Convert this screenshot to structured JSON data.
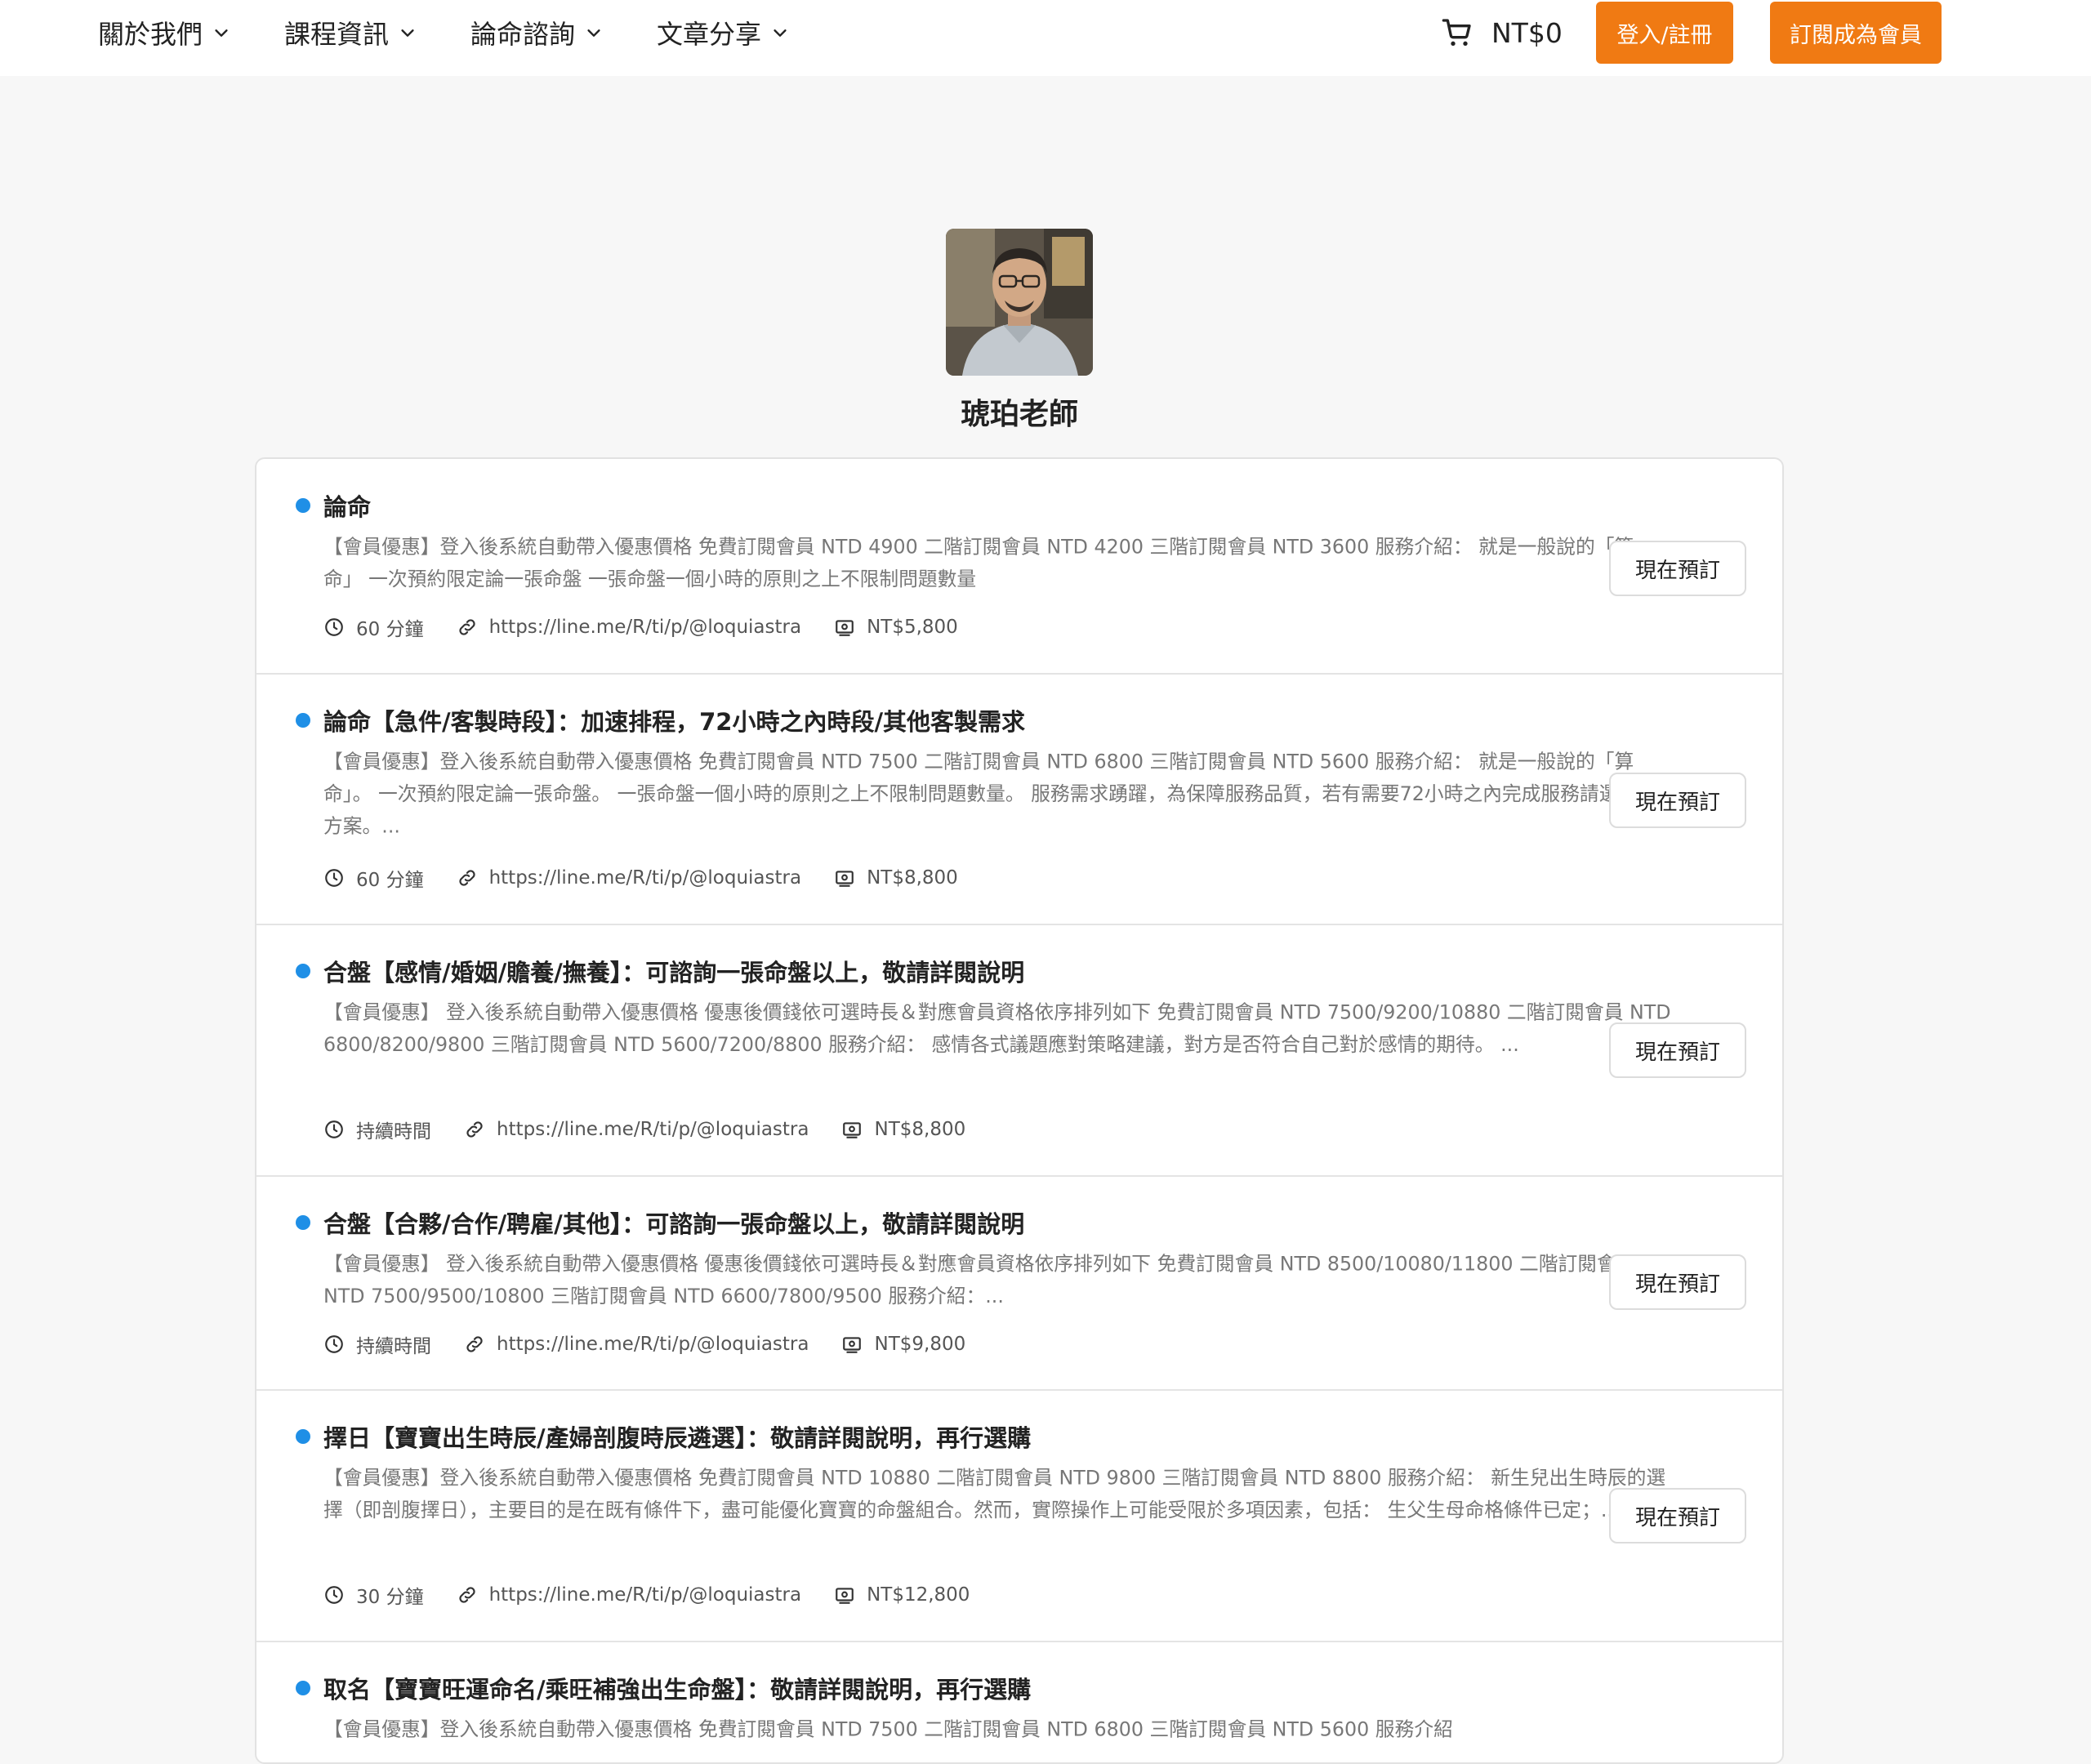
{
  "nav": {
    "items": [
      {
        "label": "關於我們"
      },
      {
        "label": "課程資訊"
      },
      {
        "label": "論命諮詢"
      },
      {
        "label": "文章分享"
      }
    ],
    "cart_total": "NT$0",
    "login_label": "登入/註冊",
    "subscribe_label": "訂閱成為會員"
  },
  "profile": {
    "name": "琥珀老師"
  },
  "colors": {
    "accent": "#f07a13",
    "bullet": "#1f8fe6"
  },
  "services": [
    {
      "title": "論命",
      "description": "【會員優惠】登入後系統自動帶入優惠價格 免費訂閱會員 NTD 4900 二階訂閱會員 NTD 4200 三階訂閱會員 NTD 3600 服務介紹： 就是一般說的「算命」 一次預約限定論一張命盤 一張命盤一個小時的原則之上不限制問題數量",
      "duration": "60 分鐘",
      "link": "https://line.me/R/ti/p/@loquiastra",
      "price": "NT$5,800",
      "book_label": "現在預訂"
    },
    {
      "title": "論命【急件/客製時段】：加速排程，72小時之內時段/其他客製需求",
      "description": "【會員優惠】登入後系統自動帶入優惠價格 免費訂閱會員 NTD 7500 二階訂閱會員 NTD 6800 三階訂閱會員 NTD 5600 服務介紹： 就是一般說的「算命」。 一次預約限定論一張命盤。 一張命盤一個小時的原則之上不限制問題數量。 服務需求踴躍，為保障服務品質，若有需要72小時之內完成服務請選擇此方案。...",
      "duration": "60 分鐘",
      "link": "https://line.me/R/ti/p/@loquiastra",
      "price": "NT$8,800",
      "book_label": "現在預訂"
    },
    {
      "title": "合盤【感情/婚姻/贍養/撫養】：可諮詢一張命盤以上，敬請詳閱說明",
      "description": "【會員優惠】 登入後系統自動帶入優惠價格 優惠後價錢依可選時長＆對應會員資格依序排列如下 免費訂閱會員 NTD 7500/9200/10880 二階訂閱會員 NTD 6800/8200/9800 三階訂閱會員 NTD 5600/7200/8800 服務介紹： 感情各式議題應對策略建議，對方是否符合自己對於感情的期待。 ...",
      "duration": "持續時間",
      "link": "https://line.me/R/ti/p/@loquiastra",
      "price": "NT$8,800",
      "book_label": "現在預訂"
    },
    {
      "title": "合盤【合夥/合作/聘雇/其他】：可諮詢一張命盤以上，敬請詳閱說明",
      "description": "【會員優惠】 登入後系統自動帶入優惠價格 優惠後價錢依可選時長＆對應會員資格依序排列如下 免費訂閱會員 NTD 8500/10080/11800 二階訂閱會員 NTD 7500/9500/10800 三階訂閱會員 NTD 6600/7800/9500 服務介紹：...",
      "duration": "持續時間",
      "link": "https://line.me/R/ti/p/@loquiastra",
      "price": "NT$9,800",
      "book_label": "現在預訂"
    },
    {
      "title": "擇日【寶寶出生時辰/產婦剖腹時辰遴選】：敬請詳閱說明，再行選購",
      "description": "【會員優惠】登入後系統自動帶入優惠價格 免費訂閱會員 NTD 10880 二階訂閱會員 NTD 9800 三階訂閱會員 NTD 8800 服務介紹： 新生兒出生時辰的選擇（即剖腹擇日），主要目的是在既有條件下，盡可能優化寶寶的命盤組合。然而，實際操作上可能受限於多項因素，包括： 生父生母命格條件已定；...",
      "duration": "30 分鐘",
      "link": "https://line.me/R/ti/p/@loquiastra",
      "price": "NT$12,800",
      "book_label": "現在預訂"
    },
    {
      "title": "取名【寶寶旺運命名/乘旺補強出生命盤】：敬請詳閱說明，再行選購",
      "description": "【會員優惠】登入後系統自動帶入優惠價格 免費訂閱會員 NTD 7500 二階訂閱會員 NTD 6800 三階訂閱會員 NTD 5600 服務介紹"
    }
  ]
}
